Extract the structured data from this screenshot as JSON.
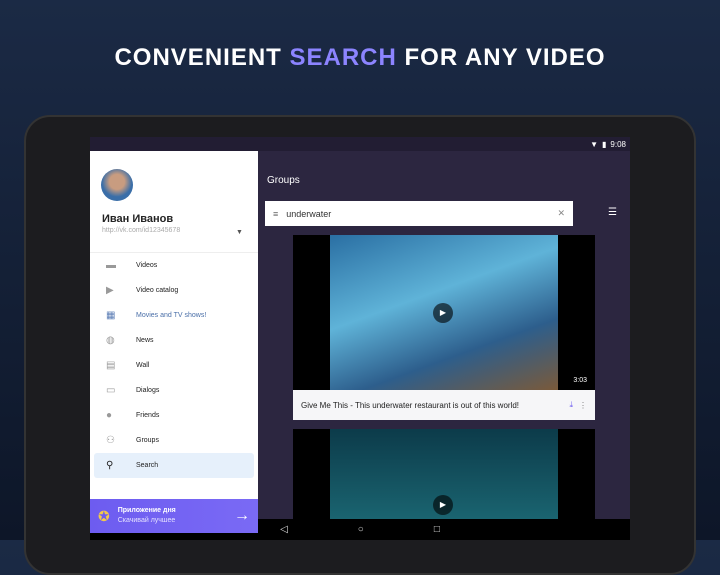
{
  "headline": {
    "pre": "CONVENIENT ",
    "accent": "SEARCH",
    "post": " FOR ANY VIDEO"
  },
  "status": {
    "time": "9:08"
  },
  "profile": {
    "name": "Иван Иванов",
    "url": "http://vk.com/id12345678"
  },
  "menu": [
    {
      "label": "Videos",
      "icon": "▬"
    },
    {
      "label": "Video catalog",
      "icon": "▶"
    },
    {
      "label": "Movies and TV shows!",
      "icon": "▦"
    },
    {
      "label": "News",
      "icon": "◍"
    },
    {
      "label": "Wall",
      "icon": "▤"
    },
    {
      "label": "Dialogs",
      "icon": "▭"
    },
    {
      "label": "Friends",
      "icon": "●"
    },
    {
      "label": "Groups",
      "icon": "⚇"
    },
    {
      "label": "Search",
      "icon": "⚲"
    }
  ],
  "promo": {
    "title": "Приложение дня",
    "subtitle": "Скачивай лучшее"
  },
  "main": {
    "title": "Groups",
    "search_value": "underwater"
  },
  "videos": [
    {
      "title": "Give Me This - This underwater restaurant is out of this world!",
      "duration": "3:03"
    }
  ]
}
